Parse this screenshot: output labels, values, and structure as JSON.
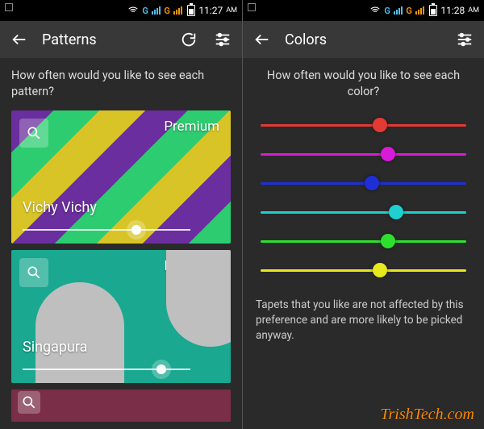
{
  "statusbar": {
    "network_a_label": "G",
    "network_b_label": "G",
    "time_left": "11:27",
    "time_right": "11:28",
    "am_pm": "AM"
  },
  "left": {
    "title": "Patterns",
    "prompt": "How often would you like to see each pattern?",
    "cards": [
      {
        "badge": "Premium",
        "name": "Vichy Vichy",
        "slider_pos": 0.65
      },
      {
        "badge": "Premium",
        "name": "Singapura",
        "slider_pos": 0.8
      }
    ]
  },
  "right": {
    "title": "Colors",
    "prompt": "How often would you like to see each color?",
    "sliders": [
      {
        "color": "#e53935",
        "pos": 0.58
      },
      {
        "color": "#d81bd8",
        "pos": 0.62
      },
      {
        "color": "#1f2fd6",
        "pos": 0.54
      },
      {
        "color": "#1fd0d0",
        "pos": 0.66
      },
      {
        "color": "#2ee02e",
        "pos": 0.62
      },
      {
        "color": "#e8e81f",
        "pos": 0.58
      }
    ],
    "helper": "Tapets that you like are not affected by this preference and are more likely to be picked anyway."
  },
  "watermark": "TrishTech.com"
}
